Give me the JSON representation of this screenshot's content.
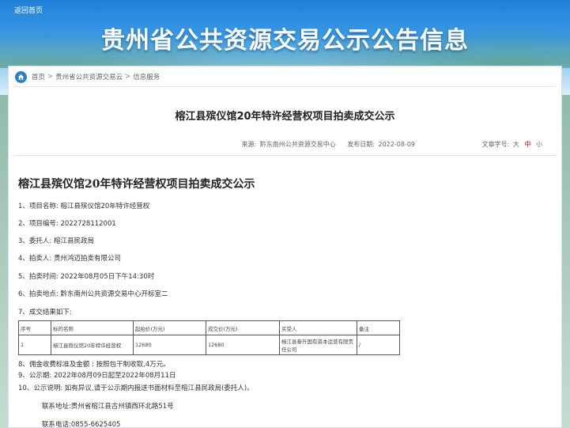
{
  "header": {
    "back_link": "返回首页",
    "title": "贵州省公共资源交易公示公告信息"
  },
  "breadcrumb": {
    "items": [
      "首页",
      "贵州省公共资源交易云",
      "信息服务"
    ],
    "separator": ">"
  },
  "notice": {
    "title": "榕江县殡仪馆20年特许经营权项目拍卖成交公示",
    "source_label": "来源:",
    "source_value": "黔东南州公共资源交易中心",
    "date_label": "发布日期:",
    "date_value": "2022-08-09",
    "font_label": "文章字号:",
    "font_sizes": [
      "大",
      "中",
      "小"
    ],
    "active_font_size": "中"
  },
  "content": {
    "title": "榕江县殡仪馆20年特许经营权项目拍卖成交公示",
    "lines": [
      "1、项目名称: 榕江县殡仪馆20年特许经营权",
      "2、项目编号: 2022728112001",
      "3、委托人:  榕江县民政局",
      "4、拍卖人: 贵州鸿迈拍卖有限公司",
      "5、拍卖时间:  2022年08月05日下午14:30时",
      "6、拍卖地点:  黔东南州公共资源交易中心开标室二",
      "7、成交结果如下:"
    ],
    "table": {
      "headers": [
        "序号",
        "标的名称",
        "起拍价(万元)",
        "成交价(万元)",
        "买受人",
        "备注"
      ],
      "rows": [
        [
          "1",
          "榕江县殡仪馆20年特许经营权",
          "12680",
          "12680",
          "榕江县泰升国有资本运营有限责任公司",
          "/"
        ]
      ]
    },
    "after_lines": [
      "8、佣金收费标准及金额 : 按照包干制收取,4万元。",
      "9、公示期: 2022年08月09日起至2022年08月11日",
      "10、公示说明: 如有异议,请于公示期内报送书面材料至榕江县民政局(委托人)。"
    ],
    "contact_address": "联系地址:贵州省榕江县古州镇西环北路51号",
    "contact_phone": "联系电话:0855-6625405"
  },
  "colors": {
    "banner": "#2a8fe0",
    "home_icon": "#2f7cc9",
    "active_size": "#cc0000"
  }
}
